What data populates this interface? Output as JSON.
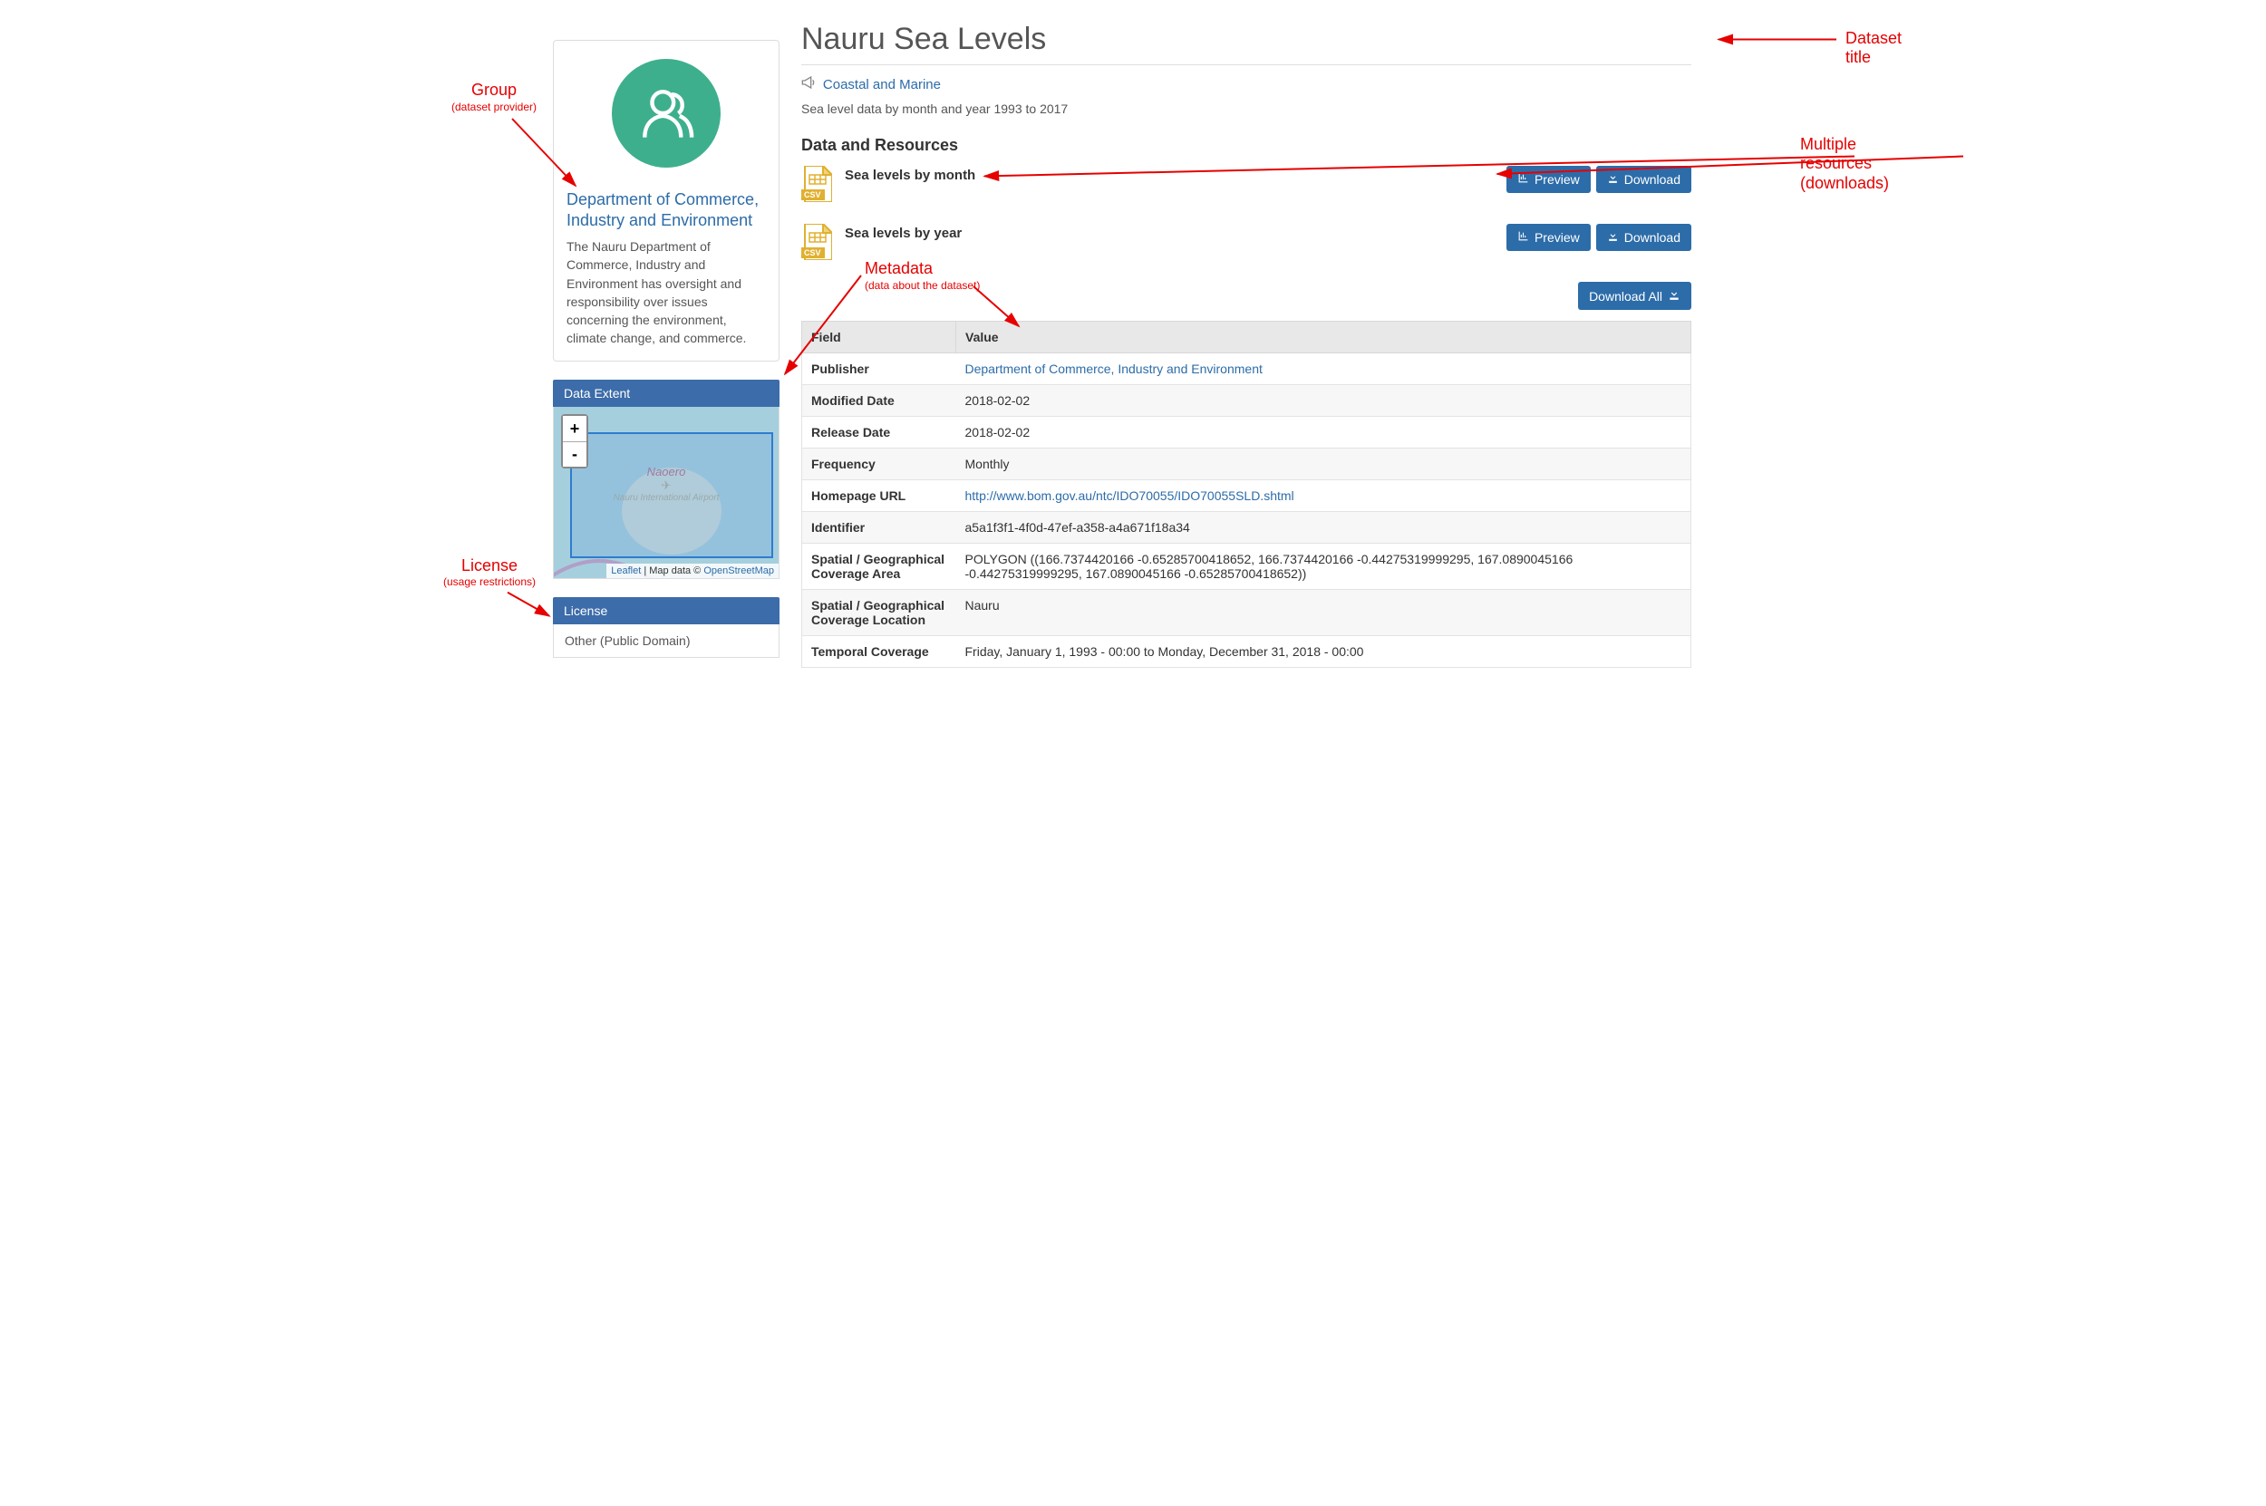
{
  "title": "Nauru Sea Levels",
  "tag": "Coastal and Marine",
  "description": "Sea level data by month and year 1993 to 2017",
  "data_resources_heading": "Data and Resources",
  "preview_label": "Preview",
  "download_label": "Download",
  "download_all_label": "Download All",
  "resources": [
    {
      "name": "Sea levels by month",
      "format": "CSV"
    },
    {
      "name": "Sea levels by year",
      "format": "CSV"
    }
  ],
  "group": {
    "name": "Department of Commerce, Industry and Environment",
    "description": "The Nauru Department of Commerce, Industry and Environment has oversight and responsibility over issues concerning the environment, climate change, and commerce."
  },
  "data_extent_heading": "Data Extent",
  "map": {
    "place": "Naoero",
    "airport": "Nauru International Airport",
    "attrib_leaflet": "Leaflet",
    "attrib_mid": " | Map data © ",
    "attrib_osm": "OpenStreetMap",
    "zoom_in": "+",
    "zoom_out": "-"
  },
  "license_heading": "License",
  "license_value": "Other (Public Domain)",
  "meta_headers": {
    "field": "Field",
    "value": "Value"
  },
  "metadata": [
    {
      "field": "Publisher",
      "value": "Department of Commerce, Industry and Environment",
      "link": true
    },
    {
      "field": "Modified Date",
      "value": "2018-02-02"
    },
    {
      "field": "Release Date",
      "value": "2018-02-02"
    },
    {
      "field": "Frequency",
      "value": "Monthly"
    },
    {
      "field": "Homepage URL",
      "value": "http://www.bom.gov.au/ntc/IDO70055/IDO70055SLD.shtml",
      "link": true
    },
    {
      "field": "Identifier",
      "value": "a5a1f3f1-4f0d-47ef-a358-a4a671f18a34"
    },
    {
      "field": "Spatial / Geographical Coverage Area",
      "value": "POLYGON ((166.7374420166 -0.65285700418652, 166.7374420166 -0.44275319999295, 167.0890045166 -0.44275319999295, 167.0890045166 -0.65285700418652))"
    },
    {
      "field": "Spatial / Geographical Coverage Location",
      "value": "Nauru"
    },
    {
      "field": "Temporal Coverage",
      "value": "Friday, January 1, 1993 - 00:00 to Monday, December 31, 2018 - 00:00"
    }
  ],
  "annotations": {
    "dataset_title": "Dataset title",
    "group": "Group",
    "group_sub": "(dataset provider)",
    "resources": "Multiple resources (downloads)",
    "metadata": "Metadata",
    "metadata_sub": "(data about the dataset)",
    "license": "License",
    "license_sub": "(usage restrictions)"
  }
}
